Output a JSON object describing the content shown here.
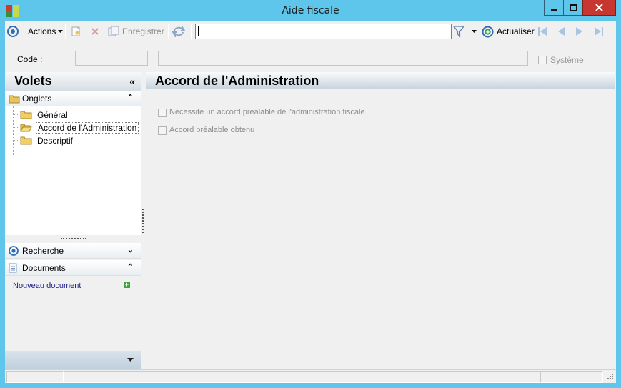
{
  "window": {
    "title": "Aide fiscale"
  },
  "toolbar": {
    "actions_label": "Actions",
    "save_label": "Enregistrer",
    "search_value": "",
    "refresh_label": "Actualiser"
  },
  "header": {
    "code_label": "Code :",
    "code_value": "",
    "description_value": "",
    "system_label": "Système"
  },
  "pane": {
    "title": "Volets",
    "tabs_section": {
      "label": "Onglets",
      "items": [
        {
          "label": "Général",
          "selected": false
        },
        {
          "label": "Accord de l'Administration",
          "selected": true
        },
        {
          "label": "Descriptif",
          "selected": false
        }
      ]
    },
    "search_section": {
      "label": "Recherche"
    },
    "documents_section": {
      "label": "Documents",
      "new_document_label": "Nouveau document"
    }
  },
  "content": {
    "title": "Accord de l'Administration",
    "options": [
      {
        "label": "Nécessite un accord préalable de l'administration fiscale",
        "checked": false
      },
      {
        "label": "Accord préalable obtenu",
        "checked": false
      }
    ]
  },
  "colors": {
    "window_frame": "#5ec6ea",
    "close_button": "#c7372f",
    "link": "#1a1a8c",
    "selection_accent": "#3a6ea5"
  },
  "icons": {
    "app": "app-logo-icon",
    "actions": "target-icon",
    "new": "new-record-icon",
    "delete": "delete-icon",
    "save": "save-icon",
    "sync": "sync-icon",
    "filter": "filter-icon",
    "refresh": "refresh-icon",
    "nav_first": "first-record-icon",
    "nav_prev": "previous-record-icon",
    "nav_next": "next-record-icon",
    "nav_last": "last-record-icon",
    "folder": "folder-icon",
    "search": "search-target-icon",
    "documents": "document-icon",
    "add": "add-icon"
  }
}
